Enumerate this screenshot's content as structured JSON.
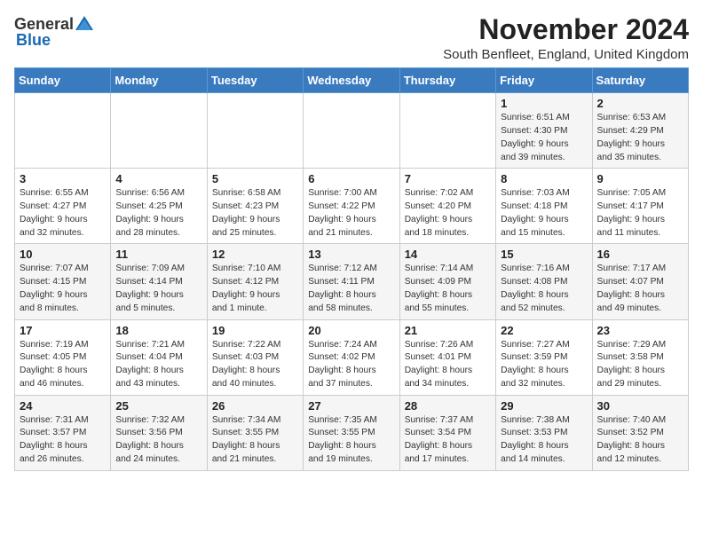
{
  "header": {
    "logo_general": "General",
    "logo_blue": "Blue",
    "month_title": "November 2024",
    "location": "South Benfleet, England, United Kingdom"
  },
  "days_of_week": [
    "Sunday",
    "Monday",
    "Tuesday",
    "Wednesday",
    "Thursday",
    "Friday",
    "Saturday"
  ],
  "weeks": [
    [
      {
        "day": "",
        "info": ""
      },
      {
        "day": "",
        "info": ""
      },
      {
        "day": "",
        "info": ""
      },
      {
        "day": "",
        "info": ""
      },
      {
        "day": "",
        "info": ""
      },
      {
        "day": "1",
        "info": "Sunrise: 6:51 AM\nSunset: 4:30 PM\nDaylight: 9 hours\nand 39 minutes."
      },
      {
        "day": "2",
        "info": "Sunrise: 6:53 AM\nSunset: 4:29 PM\nDaylight: 9 hours\nand 35 minutes."
      }
    ],
    [
      {
        "day": "3",
        "info": "Sunrise: 6:55 AM\nSunset: 4:27 PM\nDaylight: 9 hours\nand 32 minutes."
      },
      {
        "day": "4",
        "info": "Sunrise: 6:56 AM\nSunset: 4:25 PM\nDaylight: 9 hours\nand 28 minutes."
      },
      {
        "day": "5",
        "info": "Sunrise: 6:58 AM\nSunset: 4:23 PM\nDaylight: 9 hours\nand 25 minutes."
      },
      {
        "day": "6",
        "info": "Sunrise: 7:00 AM\nSunset: 4:22 PM\nDaylight: 9 hours\nand 21 minutes."
      },
      {
        "day": "7",
        "info": "Sunrise: 7:02 AM\nSunset: 4:20 PM\nDaylight: 9 hours\nand 18 minutes."
      },
      {
        "day": "8",
        "info": "Sunrise: 7:03 AM\nSunset: 4:18 PM\nDaylight: 9 hours\nand 15 minutes."
      },
      {
        "day": "9",
        "info": "Sunrise: 7:05 AM\nSunset: 4:17 PM\nDaylight: 9 hours\nand 11 minutes."
      }
    ],
    [
      {
        "day": "10",
        "info": "Sunrise: 7:07 AM\nSunset: 4:15 PM\nDaylight: 9 hours\nand 8 minutes."
      },
      {
        "day": "11",
        "info": "Sunrise: 7:09 AM\nSunset: 4:14 PM\nDaylight: 9 hours\nand 5 minutes."
      },
      {
        "day": "12",
        "info": "Sunrise: 7:10 AM\nSunset: 4:12 PM\nDaylight: 9 hours\nand 1 minute."
      },
      {
        "day": "13",
        "info": "Sunrise: 7:12 AM\nSunset: 4:11 PM\nDaylight: 8 hours\nand 58 minutes."
      },
      {
        "day": "14",
        "info": "Sunrise: 7:14 AM\nSunset: 4:09 PM\nDaylight: 8 hours\nand 55 minutes."
      },
      {
        "day": "15",
        "info": "Sunrise: 7:16 AM\nSunset: 4:08 PM\nDaylight: 8 hours\nand 52 minutes."
      },
      {
        "day": "16",
        "info": "Sunrise: 7:17 AM\nSunset: 4:07 PM\nDaylight: 8 hours\nand 49 minutes."
      }
    ],
    [
      {
        "day": "17",
        "info": "Sunrise: 7:19 AM\nSunset: 4:05 PM\nDaylight: 8 hours\nand 46 minutes."
      },
      {
        "day": "18",
        "info": "Sunrise: 7:21 AM\nSunset: 4:04 PM\nDaylight: 8 hours\nand 43 minutes."
      },
      {
        "day": "19",
        "info": "Sunrise: 7:22 AM\nSunset: 4:03 PM\nDaylight: 8 hours\nand 40 minutes."
      },
      {
        "day": "20",
        "info": "Sunrise: 7:24 AM\nSunset: 4:02 PM\nDaylight: 8 hours\nand 37 minutes."
      },
      {
        "day": "21",
        "info": "Sunrise: 7:26 AM\nSunset: 4:01 PM\nDaylight: 8 hours\nand 34 minutes."
      },
      {
        "day": "22",
        "info": "Sunrise: 7:27 AM\nSunset: 3:59 PM\nDaylight: 8 hours\nand 32 minutes."
      },
      {
        "day": "23",
        "info": "Sunrise: 7:29 AM\nSunset: 3:58 PM\nDaylight: 8 hours\nand 29 minutes."
      }
    ],
    [
      {
        "day": "24",
        "info": "Sunrise: 7:31 AM\nSunset: 3:57 PM\nDaylight: 8 hours\nand 26 minutes."
      },
      {
        "day": "25",
        "info": "Sunrise: 7:32 AM\nSunset: 3:56 PM\nDaylight: 8 hours\nand 24 minutes."
      },
      {
        "day": "26",
        "info": "Sunrise: 7:34 AM\nSunset: 3:55 PM\nDaylight: 8 hours\nand 21 minutes."
      },
      {
        "day": "27",
        "info": "Sunrise: 7:35 AM\nSunset: 3:55 PM\nDaylight: 8 hours\nand 19 minutes."
      },
      {
        "day": "28",
        "info": "Sunrise: 7:37 AM\nSunset: 3:54 PM\nDaylight: 8 hours\nand 17 minutes."
      },
      {
        "day": "29",
        "info": "Sunrise: 7:38 AM\nSunset: 3:53 PM\nDaylight: 8 hours\nand 14 minutes."
      },
      {
        "day": "30",
        "info": "Sunrise: 7:40 AM\nSunset: 3:52 PM\nDaylight: 8 hours\nand 12 minutes."
      }
    ]
  ]
}
